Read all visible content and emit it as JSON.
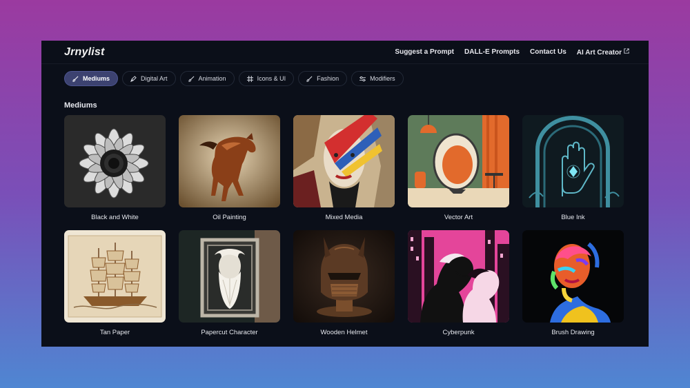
{
  "header": {
    "logo": "Jrnylist",
    "links": [
      {
        "label": "Suggest a Prompt"
      },
      {
        "label": "DALL-E Prompts"
      },
      {
        "label": "Contact Us"
      },
      {
        "label": "AI Art Creator",
        "icon": "external-link-icon"
      }
    ]
  },
  "tabs": [
    {
      "label": "Mediums",
      "icon": "brush-icon",
      "active": true
    },
    {
      "label": "Digital Art",
      "icon": "pen-icon",
      "active": false
    },
    {
      "label": "Animation",
      "icon": "brush-icon",
      "active": false
    },
    {
      "label": "Icons & UI",
      "icon": "frame-icon",
      "active": false
    },
    {
      "label": "Fashion",
      "icon": "brush-icon",
      "active": false
    },
    {
      "label": "Modifiers",
      "icon": "sliders-icon",
      "active": false
    }
  ],
  "section": {
    "title": "Mediums"
  },
  "cards": [
    {
      "label": "Black and White"
    },
    {
      "label": "Oil Painting"
    },
    {
      "label": "Mixed Media"
    },
    {
      "label": "Vector Art"
    },
    {
      "label": "Blue Ink"
    },
    {
      "label": "Tan Paper"
    },
    {
      "label": "Papercut Character"
    },
    {
      "label": "Wooden Helmet"
    },
    {
      "label": "Cyberpunk"
    },
    {
      "label": "Brush Drawing"
    }
  ],
  "colors": {
    "page_bg": "#0b0f19",
    "active_tab": "#3c4270",
    "gradient_top": "#9b3aa0",
    "gradient_bottom": "#4f86d2"
  }
}
